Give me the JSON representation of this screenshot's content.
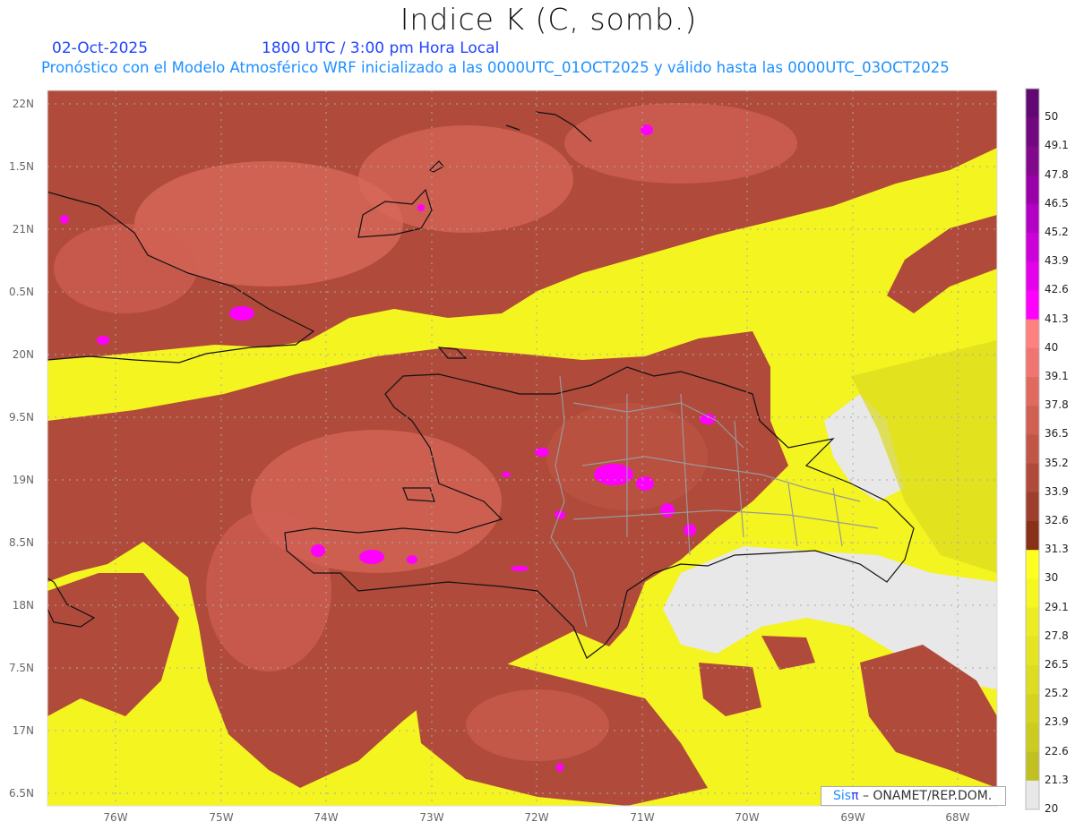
{
  "header": {
    "title": "Indice K (C, somb.)",
    "date": "02-Oct-2025",
    "time": "1800 UTC / 3:00 pm Hora Local",
    "description": "Pronóstico con el Modelo Atmosférico WRF inicializado a las 0000UTC_01OCT2025 y válido hasta las  0000UTC_03OCT2025"
  },
  "map": {
    "lat_labels": [
      "22N",
      "1.5N",
      "21N",
      "0.5N",
      "20N",
      "9.5N",
      "19N",
      "8.5N",
      "18N",
      "7.5N",
      "17N",
      "6.5N"
    ],
    "lon_labels": [
      "76W",
      "75W",
      "74W",
      "73W",
      "72W",
      "71W",
      "70W",
      "69W",
      "68W"
    ]
  },
  "colorbar": {
    "labels": [
      "50",
      "49.1",
      "47.8",
      "46.5",
      "45.2",
      "43.9",
      "42.6",
      "41.3",
      "40",
      "39.1",
      "37.8",
      "36.5",
      "35.2",
      "33.9",
      "32.6",
      "31.3",
      "30",
      "29.1",
      "27.8",
      "26.5",
      "25.2",
      "23.9",
      "22.6",
      "21.3",
      "20"
    ],
    "colors": [
      "#620872",
      "#720880",
      "#82088e",
      "#9a00a8",
      "#b400c4",
      "#cc00d8",
      "#e400ea",
      "#ff00ff",
      "#ff8080",
      "#f07470",
      "#e06a60",
      "#d06052",
      "#c05646",
      "#b04a3a",
      "#9e3e2c",
      "#883018",
      "#ffff20",
      "#f6f620",
      "#ecec22",
      "#e4e420",
      "#dcdc20",
      "#d4d420",
      "#cccc20",
      "#c0c020",
      "#e8e8e8"
    ]
  },
  "credit": {
    "brand": "Sis",
    "brand_symbol": "π",
    "org": " –  ONAMET/REP.DOM."
  }
}
